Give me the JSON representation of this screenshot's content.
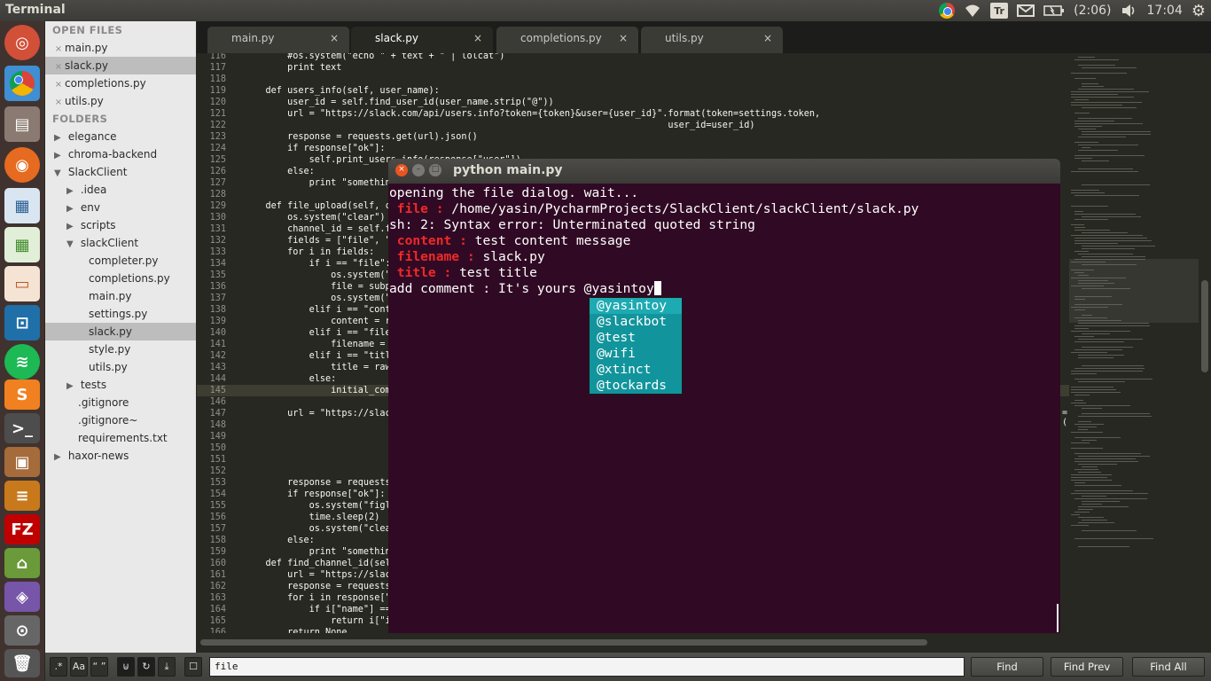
{
  "top_panel": {
    "app_title": "Terminal",
    "battery_label": "(2:06)",
    "clock": "17:04",
    "keyboard_layout": "Tr",
    "icons": [
      "chrome-icon",
      "wifi-icon",
      "keyboard-layout-icon",
      "mail-icon",
      "battery-icon",
      "volume-icon",
      "gear-icon"
    ]
  },
  "launcher": {
    "icons": [
      "ubuntu-dash-icon",
      "chrome-icon",
      "files-icon",
      "firefox-icon",
      "libreoffice-writer-icon",
      "libreoffice-calc-icon",
      "libreoffice-impress-icon",
      "app-icon",
      "spotify-icon",
      "sublime-text-icon",
      "terminal-icon",
      "package-icon",
      "stack-icon",
      "filezilla-icon",
      "app-icon",
      "app-icon",
      "app-icon",
      "app-icon",
      "trash-icon"
    ]
  },
  "sidebar": {
    "open_files_header": "OPEN FILES",
    "open_files": [
      {
        "label": "main.py",
        "close": "×"
      },
      {
        "label": "slack.py",
        "close": "×"
      },
      {
        "label": "completions.py",
        "close": "×"
      },
      {
        "label": "utils.py",
        "close": "×"
      }
    ],
    "folders_header": "FOLDERS",
    "tree": [
      {
        "label": "elegance",
        "tri": "▶"
      },
      {
        "label": "chroma-backend",
        "tri": "▶"
      },
      {
        "label": "SlackClient",
        "tri": "▼"
      },
      {
        "label": ".idea",
        "tri": "▶"
      },
      {
        "label": "env",
        "tri": "▶"
      },
      {
        "label": "scripts",
        "tri": "▶"
      },
      {
        "label": "slackClient",
        "tri": "▼"
      },
      {
        "label": "completer.py",
        "tri": ""
      },
      {
        "label": "completions.py",
        "tri": ""
      },
      {
        "label": "main.py",
        "tri": ""
      },
      {
        "label": "settings.py",
        "tri": ""
      },
      {
        "label": "slack.py",
        "tri": ""
      },
      {
        "label": "style.py",
        "tri": ""
      },
      {
        "label": "utils.py",
        "tri": ""
      },
      {
        "label": "tests",
        "tri": "▶"
      },
      {
        "label": ".gitignore",
        "tri": ""
      },
      {
        "label": ".gitignore~",
        "tri": ""
      },
      {
        "label": "requirements.txt",
        "tri": ""
      },
      {
        "label": "haxor-news",
        "tri": "▶"
      }
    ]
  },
  "tabs": [
    {
      "label": "main.py",
      "close": "×"
    },
    {
      "label": "slack.py",
      "close": "×"
    },
    {
      "label": "completions.py",
      "close": "×"
    },
    {
      "label": "utils.py",
      "close": "×"
    }
  ],
  "editor": {
    "lines": [
      {
        "n": "116",
        "text": "        #os.system(\"echo \" + text + \" | lolcat\")"
      },
      {
        "n": "117",
        "text": "        print text"
      },
      {
        "n": "118",
        "text": ""
      },
      {
        "n": "119",
        "text": "    def users_info(self, user_name):"
      },
      {
        "n": "120",
        "text": "        user_id = self.find_user_id(user_name.strip(\"@\"))"
      },
      {
        "n": "121",
        "text": "        url = \"https://slack.com/api/users.info?token={token}&user={user_id}\".format(token=settings.token,"
      },
      {
        "n": "122",
        "text": "                                                                              user_id=user_id)"
      },
      {
        "n": "123",
        "text": "        response = requests.get(url).json()"
      },
      {
        "n": "124",
        "text": "        if response[\"ok\"]:"
      },
      {
        "n": "125",
        "text": "            self.print_users_info(response[\"user\"])"
      },
      {
        "n": "126",
        "text": "        else:"
      },
      {
        "n": "127",
        "text": "            print \"something"
      },
      {
        "n": "128",
        "text": ""
      },
      {
        "n": "129",
        "text": "    def file_upload(self, c"
      },
      {
        "n": "130",
        "text": "        os.system(\"clear\")"
      },
      {
        "n": "131",
        "text": "        channel_id = self.f"
      },
      {
        "n": "132",
        "text": "        fields = [\"file\", \""
      },
      {
        "n": "133",
        "text": "        for i in fields:"
      },
      {
        "n": "134",
        "text": "            if i == \"file\":"
      },
      {
        "n": "135",
        "text": "                os.system(\""
      },
      {
        "n": "136",
        "text": "                file = subp"
      },
      {
        "n": "137",
        "text": "                os.system(\""
      },
      {
        "n": "138",
        "text": "            elif i == \"cont"
      },
      {
        "n": "139",
        "text": "                content = r"
      },
      {
        "n": "140",
        "text": "            elif i == \"file"
      },
      {
        "n": "141",
        "text": "                filename = "
      },
      {
        "n": "142",
        "text": "            elif i == \"titl"
      },
      {
        "n": "143",
        "text": "                title = raw"
      },
      {
        "n": "144",
        "text": "            else:"
      },
      {
        "n": "145",
        "text": "                initial_com"
      },
      {
        "n": "146",
        "text": ""
      },
      {
        "n": "147",
        "text": "        url = \"https://slac"
      },
      {
        "n": "148",
        "text": ""
      },
      {
        "n": "149",
        "text": ""
      },
      {
        "n": "150",
        "text": ""
      },
      {
        "n": "151",
        "text": ""
      },
      {
        "n": "152",
        "text": ""
      },
      {
        "n": "153",
        "text": "        response = requests"
      },
      {
        "n": "154",
        "text": "        if response[\"ok\"]:"
      },
      {
        "n": "155",
        "text": "            os.system(\"figl"
      },
      {
        "n": "156",
        "text": "            time.sleep(2)"
      },
      {
        "n": "157",
        "text": "            os.system(\"clea"
      },
      {
        "n": "158",
        "text": "        else:"
      },
      {
        "n": "159",
        "text": "            print \"somethin"
      },
      {
        "n": "160",
        "text": "    def find_channel_id(sel"
      },
      {
        "n": "161",
        "text": "        url = \"https://slac"
      },
      {
        "n": "162",
        "text": "        response = requests"
      },
      {
        "n": "163",
        "text": "        for i in response[\""
      },
      {
        "n": "164",
        "text": "            if i[\"name\"] =="
      },
      {
        "n": "165",
        "text": "                return i[\"i"
      },
      {
        "n": "166",
        "text": "        return None"
      }
    ],
    "overflow_marker": "=("
  },
  "terminal": {
    "title": "python main.py",
    "line1": "opening the file dialog. wait...",
    "file_key": " file : ",
    "file_value": "/home/yasin/PycharmProjects/SlackClient/slackClient/slack.py",
    "error_line": "sh: 2: Syntax error: Unterminated quoted string",
    "content_key": " content : ",
    "content_value": "test content message",
    "filename_key": " filename : ",
    "filename_value": "slack.py",
    "title_key": " title : ",
    "title_value": "test title",
    "prompt": "add comment : It's yours @yasintoy",
    "autocomplete": [
      "@yasintoy",
      "@slackbot",
      "@test",
      "@wifi",
      "@xtinct",
      "@tockards"
    ]
  },
  "find_panel": {
    "toggles": [
      ".*",
      "Aa",
      "“ ”",
      "⊍",
      "↻",
      "⤓",
      "☐"
    ],
    "query": "file",
    "find_label": "Find",
    "find_prev_label": "Find Prev",
    "find_all_label": "Find All"
  },
  "colors": {
    "editor_bg": "#272822",
    "terminal_bg": "#300a24",
    "terminal_key": "#ef2929",
    "autocomplete_bg": "#12949c",
    "sidebar_bg": "#e9e9e9",
    "launcher_bg": "#40332f"
  }
}
